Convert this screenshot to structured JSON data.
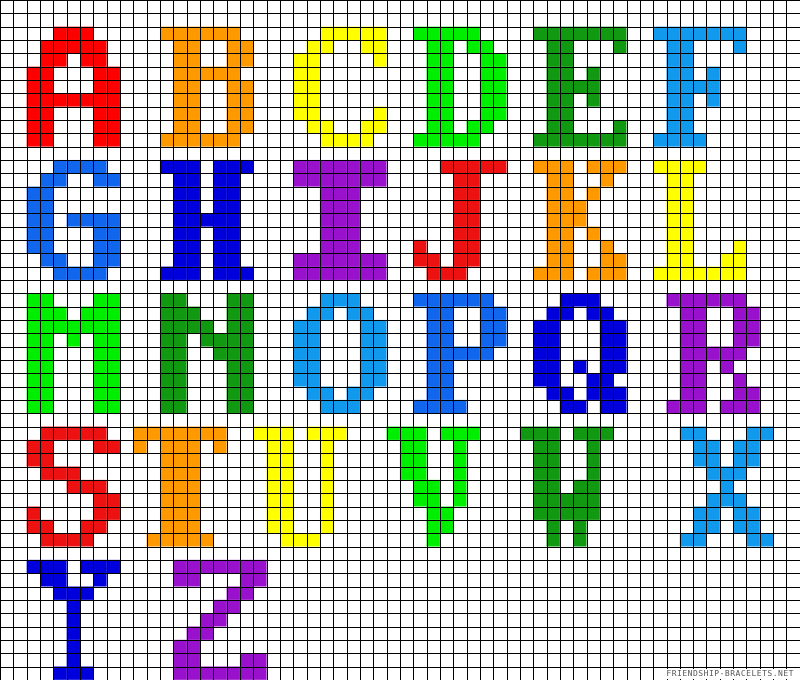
{
  "pattern": {
    "grid_line_color": "#000000",
    "background_color": "#ffffff",
    "letters": [
      {
        "char": "A",
        "color": "#ff0000"
      },
      {
        "char": "B",
        "color": "#ff9900"
      },
      {
        "char": "C",
        "color": "#ffff00"
      },
      {
        "char": "D",
        "color": "#00ee00"
      },
      {
        "char": "E",
        "color": "#119911"
      },
      {
        "char": "F",
        "color": "#1199ee"
      },
      {
        "char": "G",
        "color": "#1166ee"
      },
      {
        "char": "H",
        "color": "#0000dd"
      },
      {
        "char": "I",
        "color": "#9911cc"
      },
      {
        "char": "J",
        "color": "#ee1111"
      },
      {
        "char": "K",
        "color": "#ff9900"
      },
      {
        "char": "L",
        "color": "#ffff00"
      },
      {
        "char": "M",
        "color": "#00ee00"
      },
      {
        "char": "N",
        "color": "#119911"
      },
      {
        "char": "O",
        "color": "#1199ee"
      },
      {
        "char": "P",
        "color": "#1166ee"
      },
      {
        "char": "Q",
        "color": "#0000dd"
      },
      {
        "char": "R",
        "color": "#9911cc"
      },
      {
        "char": "S",
        "color": "#ee1111"
      },
      {
        "char": "T",
        "color": "#ff9900"
      },
      {
        "char": "U",
        "color": "#ffff00"
      },
      {
        "char": "V",
        "color": "#00ee00"
      },
      {
        "char": "W",
        "color": "#119911"
      },
      {
        "char": "X",
        "color": "#1199ee"
      },
      {
        "char": "Y",
        "color": "#0000dd"
      },
      {
        "char": "Z",
        "color": "#9911cc"
      }
    ]
  },
  "watermark": "FRIENDSHIP-BRACELETS.NET"
}
